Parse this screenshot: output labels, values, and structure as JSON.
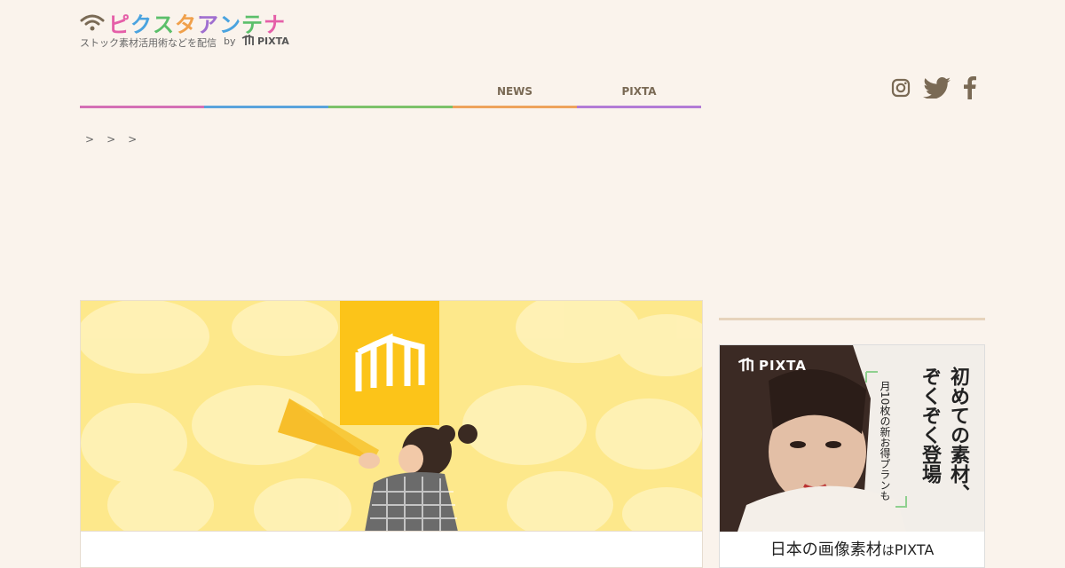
{
  "logo": {
    "title_chars": [
      "ピ",
      "ク",
      "ス",
      "タ",
      "ア",
      "ン",
      "テ",
      "ナ"
    ],
    "title_colors": [
      "#e55fa8",
      "#4aa3df",
      "#5bbf6a",
      "#f0a04b",
      "#a06fd0",
      "#4aa3df",
      "#5bbf6a",
      "#e55fa8"
    ],
    "subtitle": "ストック素材活用術などを配信",
    "by": "by",
    "brand": "PIXTA"
  },
  "nav": {
    "items": [
      {
        "label": "",
        "color": "#d46fb5"
      },
      {
        "label": "",
        "color": "#5aa3dc"
      },
      {
        "label": "",
        "color": "#7cc26a"
      },
      {
        "label": "NEWS",
        "color": "#eea35c"
      },
      {
        "label": "PIXTA",
        "color": "#b27bd6"
      }
    ]
  },
  "social": {
    "icons": [
      "instagram-icon",
      "twitter-icon",
      "facebook-icon"
    ],
    "color": "#7a6a55"
  },
  "breadcrumb": [
    ">",
    ">",
    ">"
  ],
  "article": {
    "title": ""
  },
  "sidebar": {
    "heading": ""
  },
  "ad": {
    "brand": "PIXTA",
    "headline_1": "初めての素材、",
    "headline_2": "ぞくぞく登場",
    "subline": "月10枚の新お得プランも",
    "footer_main": "日本の画像素材",
    "footer_small": "は",
    "footer_brand": "PIXTA"
  }
}
